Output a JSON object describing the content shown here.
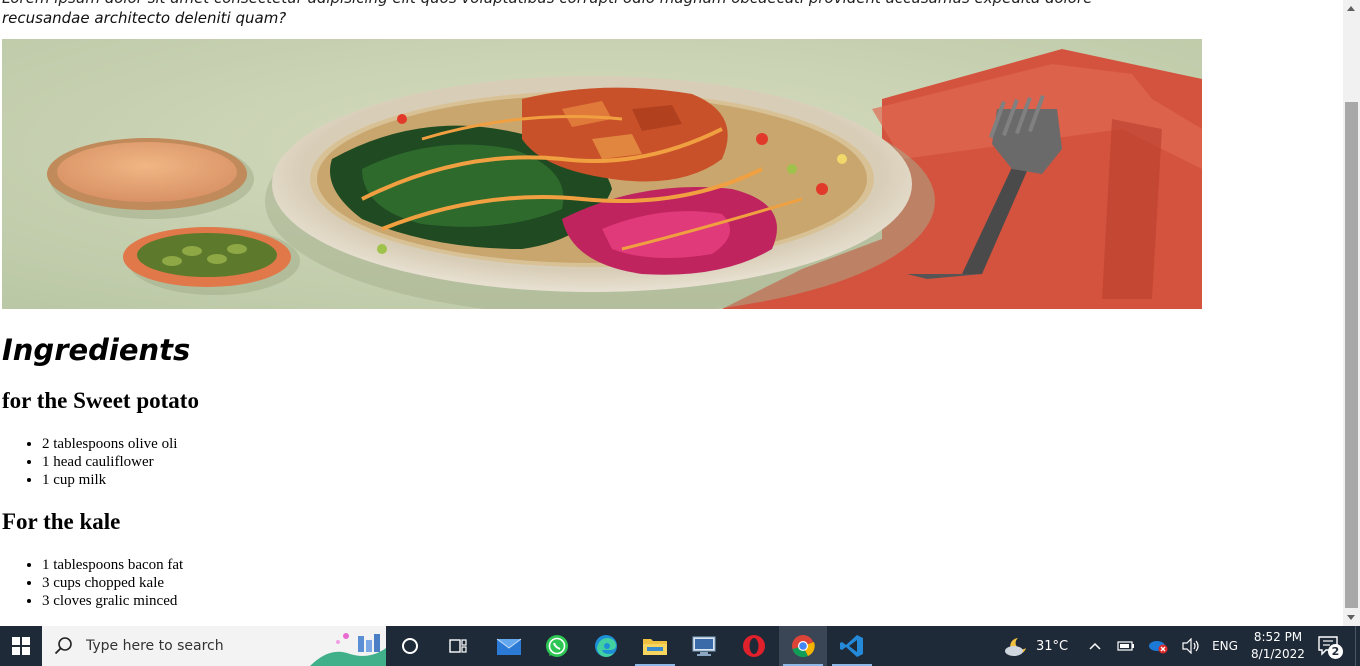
{
  "page": {
    "intro_partial": "recusandae architecto deleniti quam?",
    "ingredients_heading": "Ingredients",
    "sections": [
      {
        "title": "for the Sweet potato",
        "items": [
          "2 tablespoons olive oli",
          "1 head cauliflower",
          "1 cup milk"
        ]
      },
      {
        "title": "For the kale",
        "items": [
          "1 tablespoons bacon fat",
          "3 cups chopped kale",
          "3 cloves gralic minced"
        ]
      }
    ]
  },
  "taskbar": {
    "search_placeholder": "Type here to search",
    "weather_temp": "31°C",
    "language": "ENG",
    "time": "8:52 PM",
    "date": "8/1/2022",
    "notification_count": "2",
    "apps": [
      "start",
      "search",
      "cortana",
      "task-view",
      "mail",
      "whatsapp",
      "edge",
      "file-explorer",
      "remote-desktop",
      "opera",
      "chrome",
      "vscode"
    ]
  },
  "colors": {
    "taskbar_bg": "#1f2a38",
    "scroll_thumb": "#a8a8a8",
    "chrome_active_highlight": "#3a4656"
  }
}
